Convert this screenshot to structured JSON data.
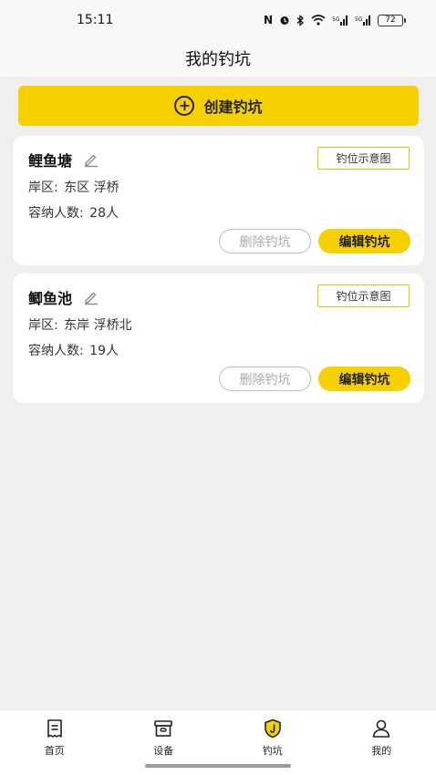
{
  "status_bar": {
    "time": "15:11",
    "battery": "72"
  },
  "header": {
    "title": "我的钓坑"
  },
  "create_button": {
    "label": "创建钓坑"
  },
  "ponds": [
    {
      "name": "鲤鱼塘",
      "map_label": "钓位示意图",
      "area_label": "岸区:",
      "area_value": "东区 浮桥",
      "capacity_label": "容纳人数:",
      "capacity_value": "28人",
      "delete_label": "删除钓坑",
      "edit_label": "编辑钓坑"
    },
    {
      "name": "鲫鱼池",
      "map_label": "钓位示意图",
      "area_label": "岸区:",
      "area_value": "东岸 浮桥北",
      "capacity_label": "容纳人数:",
      "capacity_value": "19人",
      "delete_label": "删除钓坑",
      "edit_label": "编辑钓坑"
    }
  ],
  "tabbar": {
    "items": [
      {
        "label": "首页",
        "icon": "receipt-icon"
      },
      {
        "label": "设备",
        "icon": "box-icon"
      },
      {
        "label": "钓坑",
        "icon": "shield-icon"
      },
      {
        "label": "我的",
        "icon": "user-icon"
      }
    ]
  },
  "colors": {
    "accent": "#f7d000",
    "background": "#efefef"
  }
}
